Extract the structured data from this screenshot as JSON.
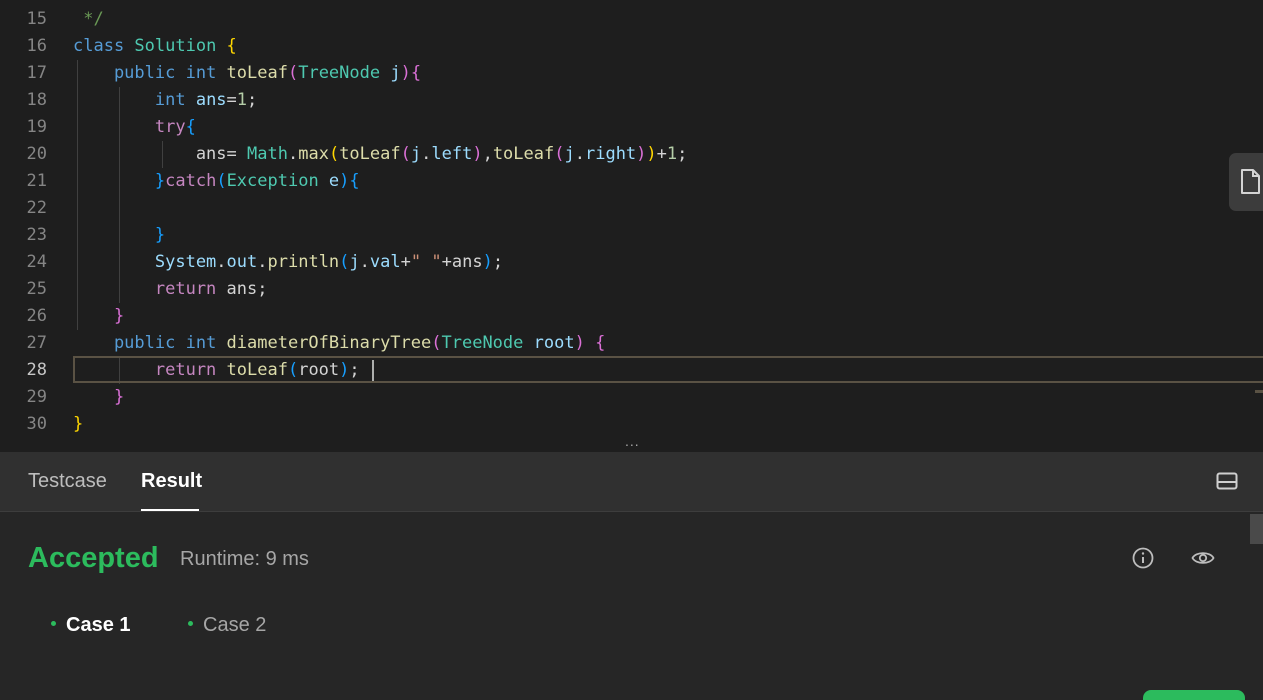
{
  "editor": {
    "lines": [
      {
        "num": "15",
        "tokens": [
          {
            "t": " */",
            "c": "cmt"
          }
        ]
      },
      {
        "num": "16",
        "tokens": [
          {
            "t": "class ",
            "c": "kw-blue"
          },
          {
            "t": "Solution",
            "c": "type"
          },
          {
            "t": " {",
            "c": "bracket-y"
          }
        ]
      },
      {
        "num": "17",
        "tokens": [
          {
            "t": "    public ",
            "c": "kw-blue"
          },
          {
            "t": "int ",
            "c": "kw-blue"
          },
          {
            "t": "toLeaf",
            "c": "fn"
          },
          {
            "t": "(",
            "c": "bracket-p"
          },
          {
            "t": "TreeNode ",
            "c": "type"
          },
          {
            "t": "j",
            "c": "var"
          },
          {
            "t": ")",
            "c": "bracket-p"
          },
          {
            "t": "{",
            "c": "bracket-p"
          }
        ]
      },
      {
        "num": "18",
        "tokens": [
          {
            "t": "        int ",
            "c": "kw-blue"
          },
          {
            "t": "ans",
            "c": "var"
          },
          {
            "t": "=",
            "c": ""
          },
          {
            "t": "1",
            "c": "num"
          },
          {
            "t": ";",
            "c": ""
          }
        ]
      },
      {
        "num": "19",
        "tokens": [
          {
            "t": "        try",
            "c": "kw-pink"
          },
          {
            "t": "{",
            "c": "bracket-b"
          }
        ]
      },
      {
        "num": "20",
        "tokens": [
          {
            "t": "            ans",
            "c": ""
          },
          {
            "t": "= ",
            "c": ""
          },
          {
            "t": "Math",
            "c": "type"
          },
          {
            "t": ".",
            "c": ""
          },
          {
            "t": "max",
            "c": "fn"
          },
          {
            "t": "(",
            "c": "bracket-y"
          },
          {
            "t": "toLeaf",
            "c": "fn"
          },
          {
            "t": "(",
            "c": "bracket-p"
          },
          {
            "t": "j",
            "c": "var"
          },
          {
            "t": ".",
            "c": ""
          },
          {
            "t": "left",
            "c": "var"
          },
          {
            "t": ")",
            "c": "bracket-p"
          },
          {
            "t": ",",
            "c": ""
          },
          {
            "t": "toLeaf",
            "c": "fn"
          },
          {
            "t": "(",
            "c": "bracket-p"
          },
          {
            "t": "j",
            "c": "var"
          },
          {
            "t": ".",
            "c": ""
          },
          {
            "t": "right",
            "c": "var"
          },
          {
            "t": ")",
            "c": "bracket-p"
          },
          {
            "t": ")",
            "c": "bracket-y"
          },
          {
            "t": "+",
            "c": ""
          },
          {
            "t": "1",
            "c": "num"
          },
          {
            "t": ";",
            "c": ""
          }
        ]
      },
      {
        "num": "21",
        "tokens": [
          {
            "t": "        }",
            "c": "bracket-b"
          },
          {
            "t": "catch",
            "c": "kw-pink"
          },
          {
            "t": "(",
            "c": "bracket-b"
          },
          {
            "t": "Exception ",
            "c": "type"
          },
          {
            "t": "e",
            "c": "var"
          },
          {
            "t": ")",
            "c": "bracket-b"
          },
          {
            "t": "{",
            "c": "bracket-b"
          }
        ]
      },
      {
        "num": "22",
        "tokens": []
      },
      {
        "num": "23",
        "tokens": [
          {
            "t": "        }",
            "c": "bracket-b"
          }
        ]
      },
      {
        "num": "24",
        "tokens": [
          {
            "t": "        System",
            "c": "var"
          },
          {
            "t": ".",
            "c": ""
          },
          {
            "t": "out",
            "c": "var"
          },
          {
            "t": ".",
            "c": ""
          },
          {
            "t": "println",
            "c": "fn"
          },
          {
            "t": "(",
            "c": "bracket-b"
          },
          {
            "t": "j",
            "c": "var"
          },
          {
            "t": ".",
            "c": ""
          },
          {
            "t": "val",
            "c": "var"
          },
          {
            "t": "+",
            "c": ""
          },
          {
            "t": "\" \"",
            "c": "str"
          },
          {
            "t": "+ans",
            "c": ""
          },
          {
            "t": ")",
            "c": "bracket-b"
          },
          {
            "t": ";",
            "c": ""
          }
        ]
      },
      {
        "num": "25",
        "tokens": [
          {
            "t": "        return ",
            "c": "kw-pink"
          },
          {
            "t": "ans",
            "c": ""
          },
          {
            "t": ";",
            "c": ""
          }
        ]
      },
      {
        "num": "26",
        "tokens": [
          {
            "t": "    }",
            "c": "bracket-p"
          }
        ]
      },
      {
        "num": "27",
        "tokens": [
          {
            "t": "    public ",
            "c": "kw-blue"
          },
          {
            "t": "int ",
            "c": "kw-blue"
          },
          {
            "t": "diameterOfBinaryTree",
            "c": "fn"
          },
          {
            "t": "(",
            "c": "bracket-p"
          },
          {
            "t": "TreeNode ",
            "c": "type"
          },
          {
            "t": "root",
            "c": "var"
          },
          {
            "t": ")",
            "c": "bracket-p"
          },
          {
            "t": " {",
            "c": "bracket-p"
          }
        ]
      },
      {
        "num": "28",
        "tokens": [
          {
            "t": "        return ",
            "c": "kw-pink"
          },
          {
            "t": "toLeaf",
            "c": "fn"
          },
          {
            "t": "(",
            "c": "bracket-b"
          },
          {
            "t": "root",
            "c": ""
          },
          {
            "t": ")",
            "c": "bracket-b"
          },
          {
            "t": ";",
            "c": ""
          }
        ]
      },
      {
        "num": "29",
        "tokens": [
          {
            "t": "    }",
            "c": "bracket-p"
          }
        ]
      },
      {
        "num": "30",
        "tokens": [
          {
            "t": "}",
            "c": "bracket-y"
          }
        ]
      }
    ],
    "active_line": "28",
    "resize_handle": "..."
  },
  "panel": {
    "tabs": [
      {
        "label": "Testcase",
        "active": false
      },
      {
        "label": "Result",
        "active": true
      }
    ],
    "status": "Accepted",
    "runtime": "Runtime: 9 ms",
    "cases": [
      {
        "label": "Case 1",
        "active": true
      },
      {
        "label": "Case 2",
        "active": false
      }
    ]
  },
  "colors": {
    "accepted": "#2cbb5d",
    "editor_bg": "#1e1e1e",
    "panel_bg": "#262626"
  },
  "icons": [
    "file-icon",
    "layout-icon",
    "info-icon",
    "eye-icon"
  ]
}
